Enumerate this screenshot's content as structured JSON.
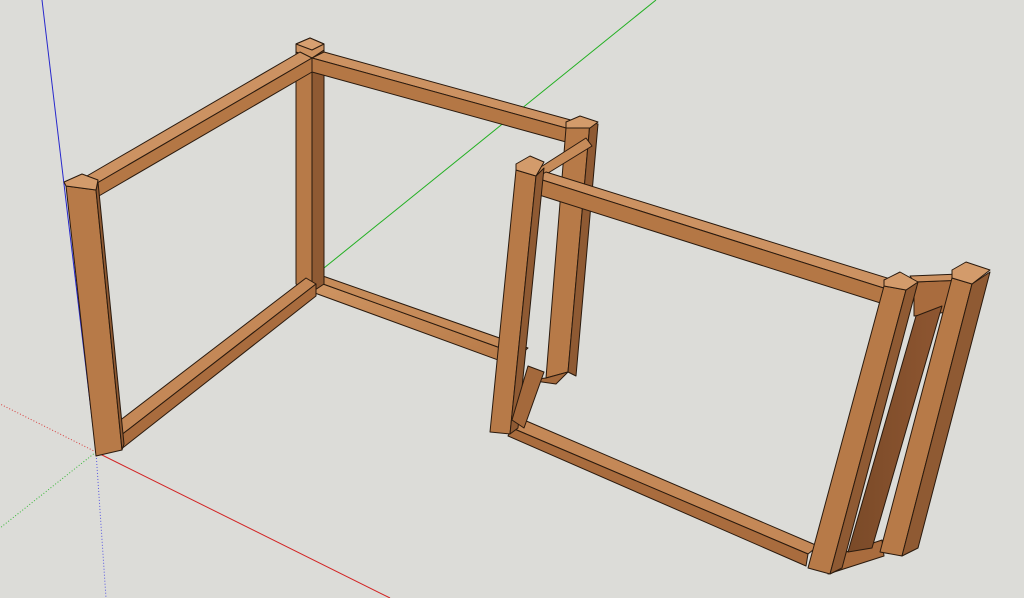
{
  "app": {
    "view": "3d-modeling-viewport",
    "background_color": "#dcdcd8"
  },
  "scene": {
    "axes": [
      {
        "name": "red-axis",
        "color": "#d22323"
      },
      {
        "name": "green-axis",
        "color": "#22b022"
      },
      {
        "name": "blue-axis",
        "color": "#2323c8"
      }
    ],
    "wood": {
      "top_color": "#c98d5c",
      "front_color": "#a86b3e",
      "side_color": "#8a5530",
      "edge_color": "#2a1a0e"
    },
    "objects": [
      {
        "name": "left-frame",
        "type": "wooden-frame"
      },
      {
        "name": "right-frame",
        "type": "wooden-frame"
      }
    ]
  }
}
